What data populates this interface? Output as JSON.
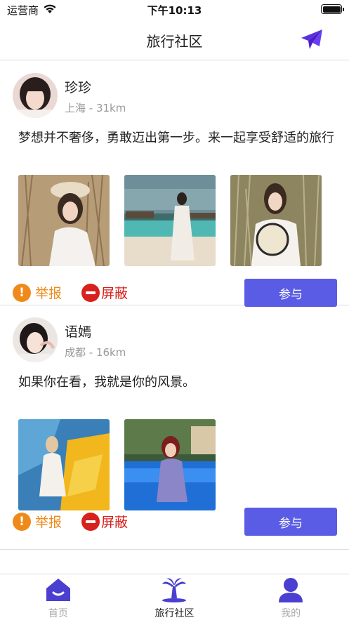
{
  "status_bar": {
    "carrier": "运营商",
    "time": "下午10:13"
  },
  "nav": {
    "title": "旅行社区"
  },
  "posts": [
    {
      "username": "珍珍",
      "location": "上海 - 31km",
      "content": "梦想并不奢侈，勇敢迈出第一步。来一起享受舒适的旅行",
      "photos": [
        "photo-1",
        "photo-2",
        "photo-3"
      ],
      "report_label": "举报",
      "block_label": "屏蔽",
      "join_label": "参与"
    },
    {
      "username": "语嫣",
      "location": "成都 - 16km",
      "content": "如果你在看，我就是你的风景。",
      "photos": [
        "photo-1",
        "photo-2"
      ],
      "report_label": "举报",
      "block_label": "屏蔽",
      "join_label": "参与"
    }
  ],
  "tabbar": {
    "items": [
      {
        "label": "首页",
        "icon": "home-icon",
        "active": false
      },
      {
        "label": "旅行社区",
        "icon": "palm-tree-icon",
        "active": true
      },
      {
        "label": "我的",
        "icon": "person-icon",
        "active": false
      }
    ]
  },
  "colors": {
    "accent": "#5a5ce6",
    "report": "#ef8a1a",
    "block": "#d8201c",
    "tab_icon": "#4a3fd0"
  }
}
